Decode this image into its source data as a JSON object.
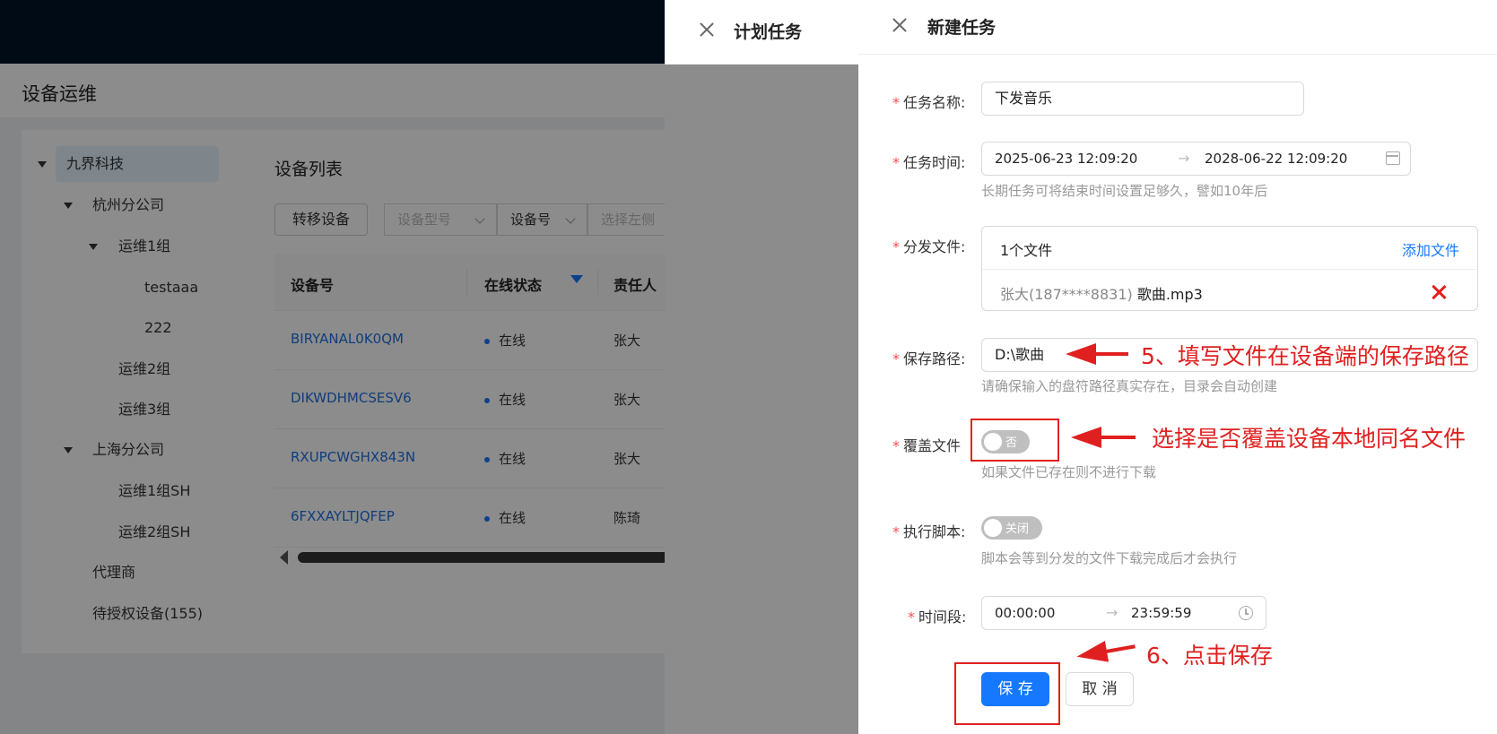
{
  "page": {
    "title": "设备运维"
  },
  "tree": [
    {
      "label": "九界科技",
      "expanded": true,
      "selected": true
    },
    {
      "label": "杭州分公司",
      "expanded": true
    },
    {
      "label": "运维1组",
      "expanded": true
    },
    {
      "label": "testaaa"
    },
    {
      "label": "222"
    },
    {
      "label": "运维2组"
    },
    {
      "label": "运维3组"
    },
    {
      "label": "上海分公司",
      "expanded": true
    },
    {
      "label": "运维1组SH"
    },
    {
      "label": "运维2组SH"
    },
    {
      "label": "代理商"
    },
    {
      "label": "待授权设备(155)"
    }
  ],
  "device_list": {
    "title": "设备列表",
    "transfer_button": "转移设备",
    "filter_model_placeholder": "设备型号",
    "filter_field": "设备号",
    "filter_search_placeholder": "选择左侧",
    "columns": [
      "设备号",
      "在线状态",
      "责任人"
    ],
    "rows": [
      {
        "id": "BIRYANAL0K0QM",
        "status": "在线",
        "owner": "张大"
      },
      {
        "id": "DIKWDHMCSESV6",
        "status": "在线",
        "owner": "张大"
      },
      {
        "id": "RXUPCWGHX843N",
        "status": "在线",
        "owner": "张大"
      },
      {
        "id": "6FXXAYLTJQFEP",
        "status": "在线",
        "owner": "陈琦"
      }
    ]
  },
  "plan_drawer": {
    "title": "计划任务"
  },
  "new_task": {
    "title": "新建任务",
    "task_name": {
      "label": "任务名称:",
      "value": "下发音乐"
    },
    "task_time": {
      "label": "任务时间:",
      "start": "2025-06-23 12:09:20",
      "end": "2028-06-22 12:09:20",
      "hint": "长期任务可将结束时间设置足够久，譬如10年后"
    },
    "files": {
      "label": "分发文件:",
      "count": "1个文件",
      "add_label": "添加文件",
      "items": [
        {
          "owner": "张大(187****8831)",
          "name": "歌曲.mp3"
        }
      ]
    },
    "save_path": {
      "label": "保存路径:",
      "value": "D:\\歌曲",
      "hint": "请确保输入的盘符路径真实存在，目录会自动创建"
    },
    "overwrite": {
      "label": "覆盖文件",
      "switch_text": "否",
      "hint": "如果文件已存在则不进行下载"
    },
    "run_script": {
      "label": "执行脚本:",
      "switch_text": "关闭",
      "hint": "脚本会等到分发的文件下载完成后才会执行"
    },
    "time_window": {
      "label": "时间段:",
      "start": "00:00:00",
      "end": "23:59:59"
    },
    "save_button": "保 存",
    "cancel_button": "取 消"
  },
  "annotations": {
    "save_path": "5、填写文件在设备端的保存路径",
    "overwrite": "选择是否覆盖设备本地同名文件",
    "save": "6、点击保存"
  },
  "colors": {
    "accent": "#1677ff",
    "annotation": "#e02020",
    "topbar": "#001529"
  }
}
